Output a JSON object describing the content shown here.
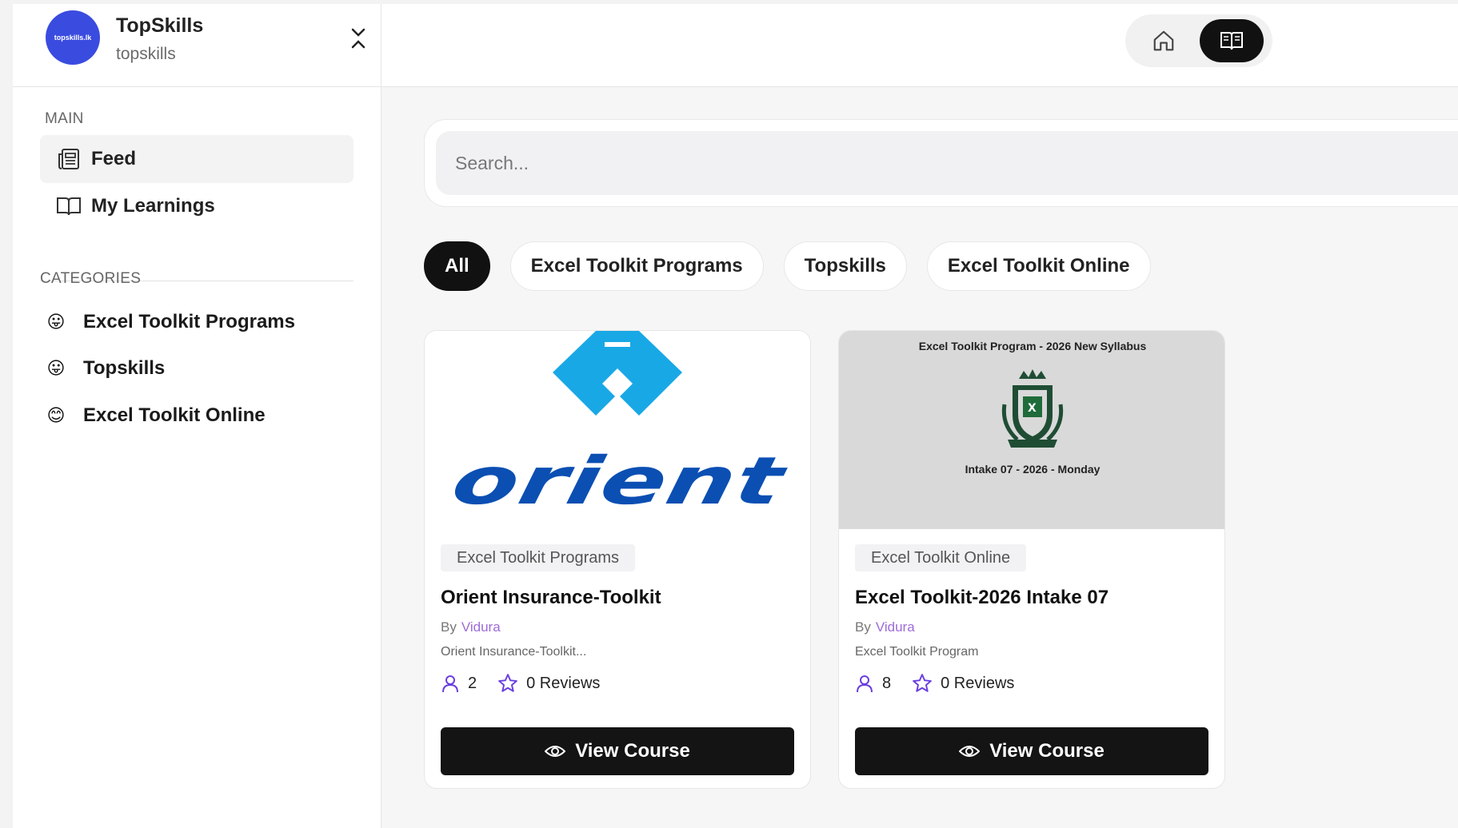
{
  "brand": {
    "logo_text": "topskills.lk",
    "name": "TopSkills",
    "handle": "topskills"
  },
  "sidebar": {
    "main_title": "MAIN",
    "main_items": [
      {
        "label": "Feed",
        "icon": "newspaper-icon",
        "active": true
      },
      {
        "label": "My Learnings",
        "icon": "book-open-icon",
        "active": false
      }
    ],
    "categories_title": "CATEGORIES",
    "categories": [
      {
        "label": "Excel Toolkit Programs",
        "emoji": "😛"
      },
      {
        "label": "Topskills",
        "emoji": "😛"
      },
      {
        "label": "Excel Toolkit Online",
        "emoji": "😊"
      }
    ]
  },
  "search": {
    "placeholder": "Search..."
  },
  "filters": [
    "All",
    "Excel Toolkit Programs",
    "Topskills",
    "Excel Toolkit Online"
  ],
  "courses": [
    {
      "thumb_text": "orient",
      "tag": "Excel Toolkit Programs",
      "title": "Orient Insurance-Toolkit",
      "by": "By",
      "author": "Vidura",
      "description": "Orient Insurance-Toolkit...",
      "students": "2",
      "reviews": "0 Reviews",
      "button": "View Course"
    },
    {
      "thumb_top": "Excel Toolkit Program - 2026 New Syllabus",
      "thumb_bottom": "Intake 07 - 2026 - Monday",
      "tag": "Excel Toolkit Online",
      "title": "Excel Toolkit-2026 Intake 07",
      "by": "By",
      "author": "Vidura",
      "description": "Excel Toolkit Program",
      "students": "8",
      "reviews": "0 Reviews",
      "button": "View Course"
    }
  ],
  "colors": {
    "brand": "#3a4be0",
    "primary": "#111111",
    "accent": "#6a3ee0",
    "author": "#9d6bd8",
    "orient_cyan": "#19a8e6",
    "orient_blue": "#0b4fb3"
  }
}
